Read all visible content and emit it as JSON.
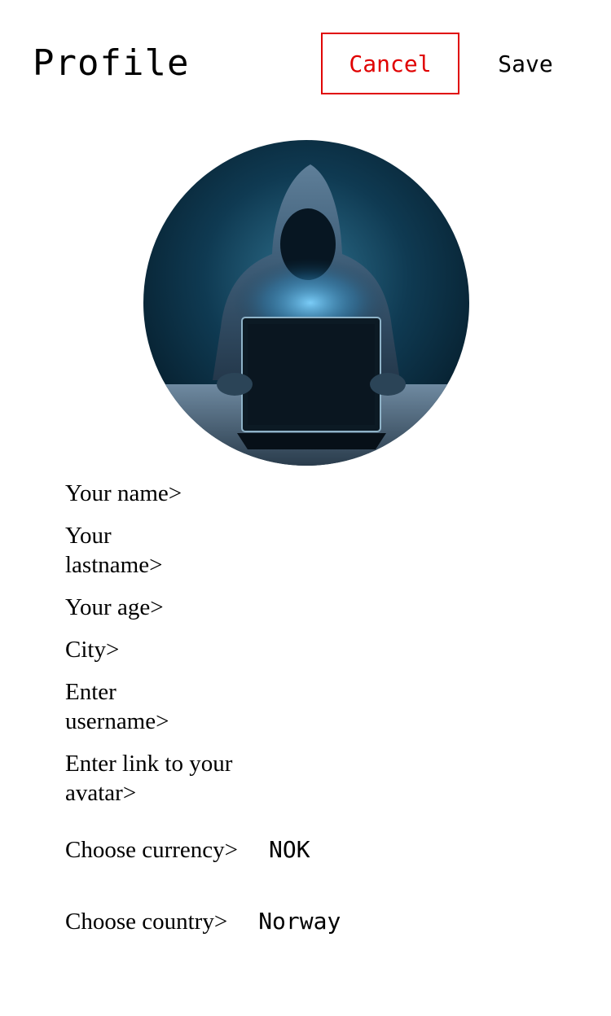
{
  "header": {
    "title": "Profile",
    "cancel_label": "Cancel",
    "save_label": "Save"
  },
  "avatar": {
    "icon": "hooded-hacker-avatar"
  },
  "form": {
    "name_label": "Your name>",
    "lastname_label": "Your lastname>",
    "age_label": "Your age>",
    "city_label": "City>",
    "username_label": "Enter username>",
    "avatar_link_label": "Enter link to your avatar>",
    "currency_label": "Choose currency>",
    "currency_value": "NOK",
    "country_label": "Choose country>",
    "country_value": "Norway"
  },
  "colors": {
    "accent": "#e00000",
    "text": "#000000",
    "background": "#ffffff"
  }
}
